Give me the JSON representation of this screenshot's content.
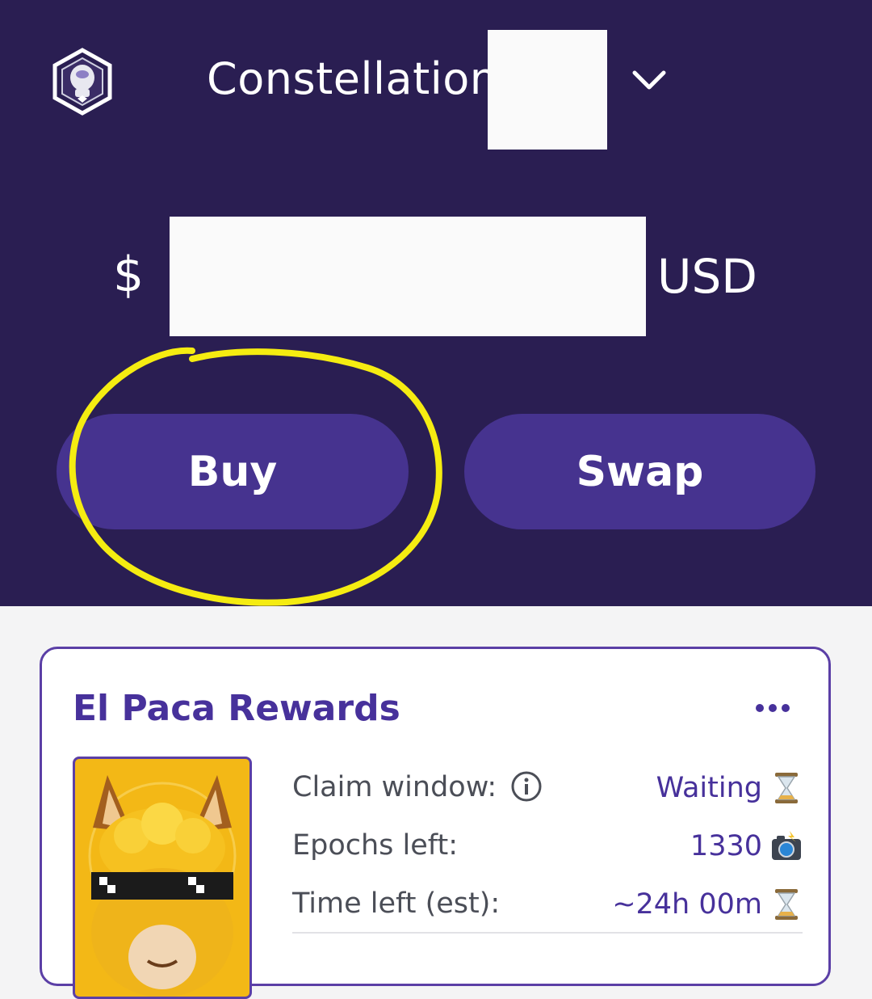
{
  "header": {
    "network_name": "Constellation",
    "currency_symbol": "$",
    "currency_code": "USD",
    "colors": {
      "background": "#2a1e52",
      "button": "#46338f",
      "highlight": "#f5ec11"
    }
  },
  "actions": {
    "buy_label": "Buy",
    "swap_label": "Swap"
  },
  "rewards_card": {
    "title": "El Paca Rewards",
    "rows": [
      {
        "label": "Claim window:",
        "value": "Waiting",
        "icon": "hourglass-icon"
      },
      {
        "label": "Epochs left:",
        "value": "1330",
        "icon": "camera-flash-icon"
      },
      {
        "label": "Time left (est):",
        "value": "~24h 00m",
        "icon": "hourglass-icon"
      }
    ],
    "colors": {
      "accent": "#47319b",
      "border": "#5b3fa6"
    }
  }
}
